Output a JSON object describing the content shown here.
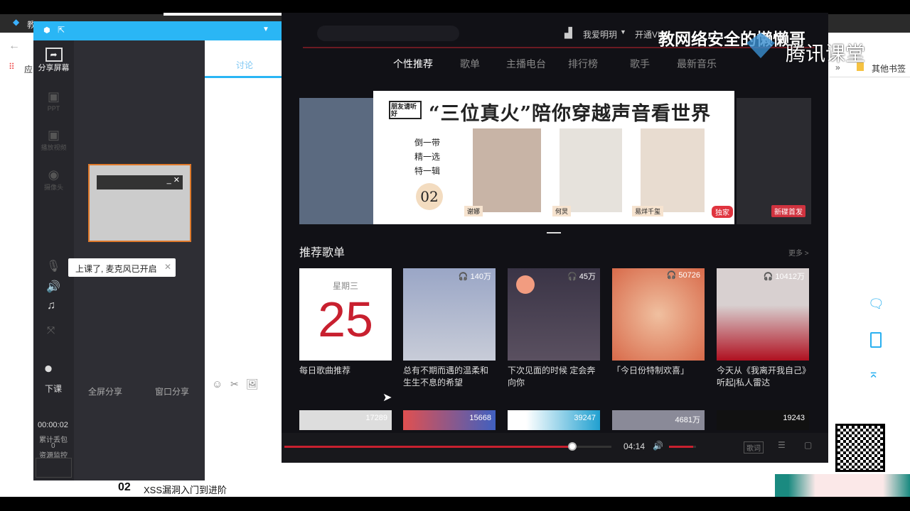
{
  "browser": {
    "tab_title": "教...",
    "bookmarks_apps": "应",
    "bookmarks_other": "其他书签",
    "overflow": "»"
  },
  "watermark": {
    "text": "教网络安全的懒懒哥",
    "brand": "腾讯课堂"
  },
  "classroom": {
    "side": [
      {
        "label": "分享屏幕",
        "icon": "share-screen-icon"
      },
      {
        "label": "PPT",
        "icon": "ppt-icon"
      },
      {
        "label": "播放视频",
        "icon": "video-icon"
      },
      {
        "label": "摄像头",
        "icon": "camera-icon"
      }
    ],
    "tooltip": "上课了, 麦克风已开启",
    "end_class": "下课",
    "timer": "00:00:02",
    "packet_loss_label": "累计丢包",
    "packet_loss": "0",
    "monitor": "资源监控",
    "fullscreen_share": "全屏分享",
    "window_share": "窗口分享",
    "discussion_tab": "讨论"
  },
  "music": {
    "user": "我爱明玥",
    "vip": "开通VIP",
    "tabs": [
      "个性推荐",
      "歌单",
      "主播电台",
      "排行榜",
      "歌手",
      "最新音乐"
    ],
    "banner": {
      "logo": "朋友请听好",
      "title": "“三位真火”陪你穿越声音看世界",
      "lines": [
        "倒一带",
        "精一选",
        "特一辑"
      ],
      "episode": "02",
      "names": [
        "何炅",
        "谢娜",
        "易烊千玺"
      ],
      "badge": "独家",
      "side_badge": "新碟首发"
    },
    "section_title": "推荐歌单",
    "more": "更多 >",
    "daily": {
      "weekday": "星期三",
      "day": "25"
    },
    "playlists": [
      {
        "title": "每日歌曲推荐",
        "count": ""
      },
      {
        "title": "总有不期而遇的温柔和生生不息的希望",
        "count": "140万"
      },
      {
        "title": "下次见面的时候 定会奔向你",
        "count": "45万"
      },
      {
        "title": "「今日份特制欢喜」",
        "count": "50726"
      },
      {
        "title": "今天从《我离开我自己》听起|私人雷达",
        "count": "10412万"
      }
    ],
    "row2_counts": [
      "17289",
      "15668",
      "39247",
      "4681万",
      "19243"
    ],
    "player": {
      "time": "04:14",
      "progress": 0.88,
      "volume": 0.9,
      "lyrics": "歌词"
    }
  },
  "footer": {
    "episode": "02",
    "course": "XSS漏洞入门到进阶"
  }
}
